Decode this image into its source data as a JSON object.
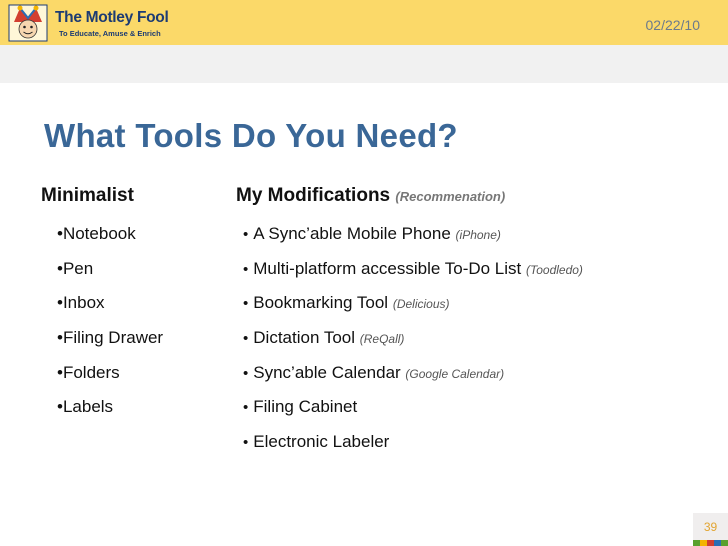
{
  "header": {
    "brand_name": "The Motley Fool",
    "brand_tag": "To Educate, Amuse & Enrich",
    "date": "02/22/10"
  },
  "slide": {
    "title": "What Tools Do You Need?",
    "left_heading": "Minimalist",
    "right_heading": "My Modifications",
    "right_heading_note": "(Recommenation)",
    "left_items": [
      "•Notebook",
      "•Pen",
      "•Inbox",
      "•Filing Drawer",
      "•Folders",
      "•Labels"
    ],
    "right_items": [
      {
        "text": "A Sync’able Mobile Phone",
        "note": "(iPhone)"
      },
      {
        "text": "Multi-platform accessible To-Do List",
        "note": "(Toodledo)"
      },
      {
        "text": "Bookmarking Tool",
        "note": "(Delicious)"
      },
      {
        "text": "Dictation Tool",
        "note": "(ReQall)"
      },
      {
        "text": "Sync’able Calendar",
        "note": "(Google Calendar)"
      },
      {
        "text": "Filing Cabinet",
        "note": ""
      },
      {
        "text": "Electronic Labeler",
        "note": ""
      }
    ],
    "bullet": "•"
  },
  "footer": {
    "page_number": "39",
    "stripe_colors": [
      "#5aa02c",
      "#f4b400",
      "#d23f31",
      "#2a6db5",
      "#5aa02c"
    ]
  },
  "colors": {
    "header_bg": "#fbd969",
    "title": "#3a6797",
    "page_number": "#e2a532"
  }
}
